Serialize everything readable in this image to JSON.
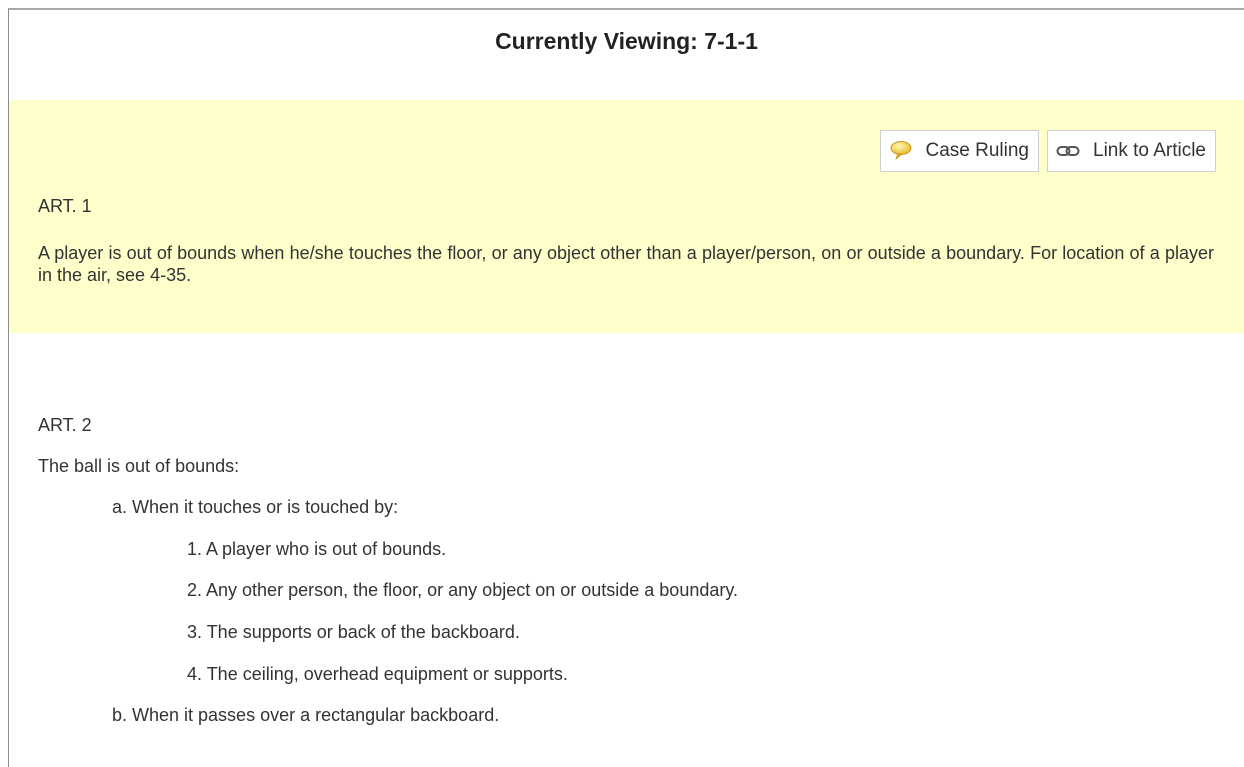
{
  "header": {
    "title": "Currently Viewing: 7-1-1"
  },
  "toolbar": {
    "case_ruling_label": "Case Ruling",
    "case_ruling_icon": "speech-bubble-icon",
    "link_label": "Link to Article",
    "link_icon": "chain-link-icon"
  },
  "article1": {
    "heading": "ART. 1",
    "text": "A player is out of bounds when he/she touches the floor, or any object other than a player/person, on or outside a boundary. For location of a player in the air, see 4-35."
  },
  "article2": {
    "heading": "ART. 2",
    "intro": "The ball is out of bounds:",
    "items": [
      {
        "label": "a. When it touches or is touched by:",
        "subitems": [
          "1. A player who is out of bounds.",
          "2. Any other person, the floor, or any object on or outside a boundary.",
          "3. The supports or back of the backboard.",
          "4. The ceiling, overhead equipment or supports."
        ]
      },
      {
        "label": "b. When it passes over a rectangular backboard.",
        "subitems": []
      }
    ]
  },
  "colors": {
    "highlight_background": "#ffffcc",
    "text": "#333333",
    "title": "#222222"
  }
}
